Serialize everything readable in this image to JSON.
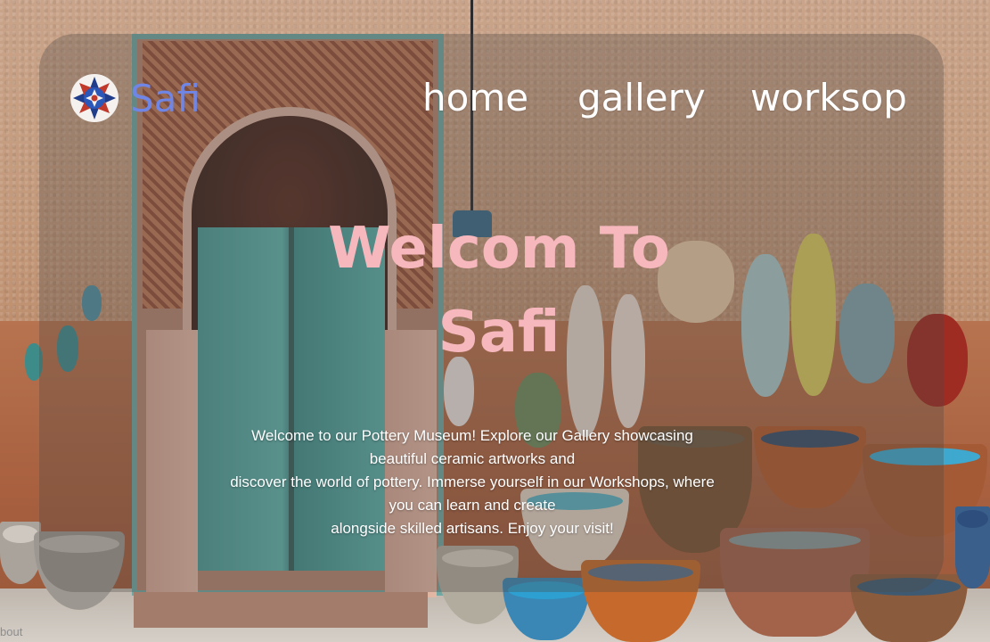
{
  "header": {
    "brand": "Safi",
    "logo_icon": "mandala-tile-icon",
    "nav": [
      {
        "label": "home"
      },
      {
        "label": "gallery"
      },
      {
        "label": "worksop"
      }
    ]
  },
  "hero": {
    "title_line1": "Welcom To",
    "title_line2": "Safi",
    "description_lines": [
      "Welcome to our Pottery Museum! Explore our Gallery showcasing",
      "beautiful ceramic artworks and",
      "discover the world of pottery. Immerse yourself in our Workshops, where",
      "you can learn and create",
      "alongside skilled artisans. Enjoy your visit!"
    ]
  },
  "footer": {
    "partial_link": "bout"
  },
  "colors": {
    "brand": "#6f86e6",
    "title": "#f6b7bd",
    "nav": "#ffffff",
    "overlay": "rgba(78,70,68,0.32)"
  }
}
